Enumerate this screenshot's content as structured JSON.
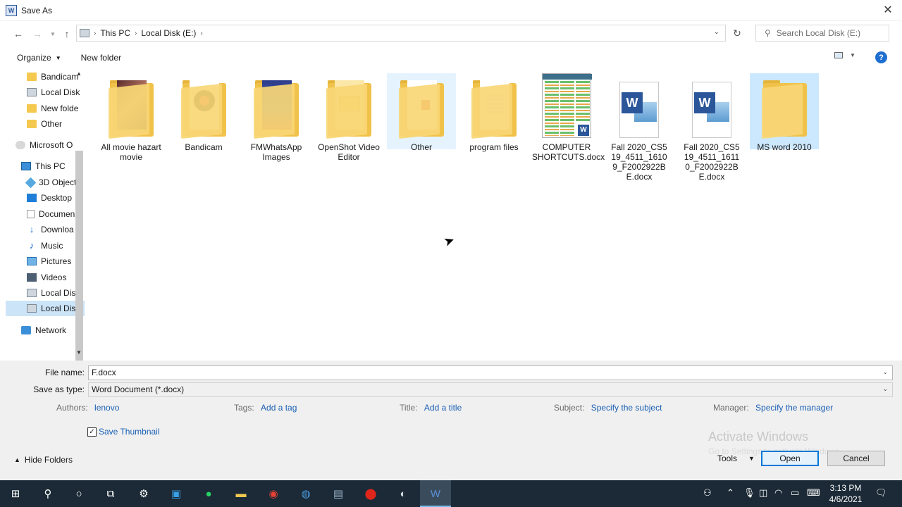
{
  "window": {
    "title": "Save As",
    "app_icon_text": "W"
  },
  "address": {
    "crumbs": [
      "This PC",
      "Local Disk (E:)"
    ],
    "search_placeholder": "Search Local Disk (E:)"
  },
  "toolbar": {
    "organize": "Organize",
    "new_folder": "New folder",
    "help": "?"
  },
  "sidebar": {
    "items": [
      {
        "label": "Bandicam",
        "icon": "folder-icon"
      },
      {
        "label": "Local Disk",
        "icon": "drive-icon"
      },
      {
        "label": "New folde",
        "icon": "folder-icon"
      },
      {
        "label": "Other",
        "icon": "folder-icon"
      },
      {
        "label": "Microsoft O",
        "icon": "cloud-icon"
      },
      {
        "label": "This PC",
        "icon": "pc-icon"
      },
      {
        "label": "3D Object",
        "icon": "cube-icon"
      },
      {
        "label": "Desktop",
        "icon": "desktop-icon"
      },
      {
        "label": "Documen",
        "icon": "document-icon"
      },
      {
        "label": "Downloa",
        "icon": "download-icon"
      },
      {
        "label": "Music",
        "icon": "music-icon"
      },
      {
        "label": "Pictures",
        "icon": "pictures-icon"
      },
      {
        "label": "Videos",
        "icon": "videos-icon"
      },
      {
        "label": "Local Disk",
        "icon": "drive-icon"
      },
      {
        "label": "Local Disk",
        "icon": "drive-icon"
      },
      {
        "label": "Network",
        "icon": "network-icon"
      }
    ]
  },
  "files": [
    {
      "name": "All movie hazart movie",
      "type": "folder"
    },
    {
      "name": "Bandicam",
      "type": "folder"
    },
    {
      "name": "FMWhatsApp Images",
      "type": "folder"
    },
    {
      "name": "OpenShot Video Editor",
      "type": "folder"
    },
    {
      "name": "Other",
      "type": "folder",
      "state": "hover"
    },
    {
      "name": "program files",
      "type": "folder"
    },
    {
      "name": "COMPUTER SHORTCUTS.docx",
      "type": "docx-image"
    },
    {
      "name": "Fall 2020_CS519_4511_16109_F2002922BE.docx",
      "type": "docx"
    },
    {
      "name": "Fall 2020_CS519_4511_16110_F2002922BE.docx",
      "type": "docx"
    },
    {
      "name": "MS word 2010",
      "type": "folder",
      "state": "selected"
    }
  ],
  "form": {
    "file_name_label": "File name:",
    "file_name_value": "F.docx",
    "save_type_label": "Save as type:",
    "save_type_value": "Word Document (*.docx)",
    "authors_label": "Authors:",
    "authors_value": "lenovo",
    "tags_label": "Tags:",
    "tags_value": "Add a tag",
    "title_label": "Title:",
    "title_value": "Add a title",
    "subject_label": "Subject:",
    "subject_value": "Specify the subject",
    "manager_label": "Manager:",
    "manager_value": "Specify the manager",
    "save_thumbnail": "Save Thumbnail",
    "save_thumbnail_checked": true,
    "hide_folders": "Hide Folders",
    "tools": "Tools",
    "open_button": "Open",
    "cancel_button": "Cancel"
  },
  "watermark": {
    "line1": "Activate Windows",
    "line2": "Go to Settings to activate Windows."
  },
  "taskbar": {
    "time": "3:13 PM",
    "date": "4/6/2021"
  },
  "colors": {
    "accent": "#0078d7",
    "link": "#1a5fb4",
    "selection": "#cce8ff",
    "taskbar": "#1b2a36"
  }
}
